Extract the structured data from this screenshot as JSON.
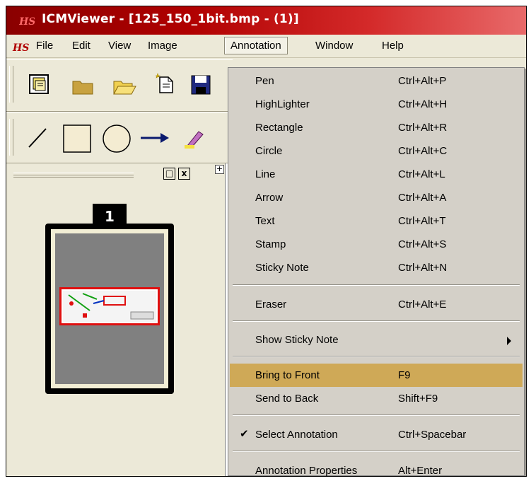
{
  "window": {
    "title": "ICMViewer - [125_150_1bit.bmp - (1)]"
  },
  "menubar": {
    "items": [
      "File",
      "Edit",
      "View",
      "Image",
      "Annotation",
      "Window",
      "Help"
    ]
  },
  "toolbar1": {
    "icons": [
      "scan-document-icon",
      "open-folder-icon",
      "open-folder-alt-icon",
      "new-page-icon",
      "save-icon"
    ]
  },
  "toolbar2": {
    "icons": [
      "line-tool-icon",
      "rectangle-tool-icon",
      "circle-tool-icon",
      "arrow-tool-icon",
      "highlighter-tool-icon"
    ]
  },
  "thumbnail": {
    "page_number": "1"
  },
  "pane": {
    "restore_label": "□",
    "close_label": "x"
  },
  "annotation_menu": {
    "items": [
      {
        "label": "Pen",
        "shortcut": "Ctrl+Alt+P"
      },
      {
        "label": "HighLighter",
        "shortcut": "Ctrl+Alt+H"
      },
      {
        "label": "Rectangle",
        "shortcut": "Ctrl+Alt+R"
      },
      {
        "label": "Circle",
        "shortcut": "Ctrl+Alt+C"
      },
      {
        "label": "Line",
        "shortcut": "Ctrl+Alt+L"
      },
      {
        "label": "Arrow",
        "shortcut": "Ctrl+Alt+A"
      },
      {
        "label": "Text",
        "shortcut": "Ctrl+Alt+T"
      },
      {
        "label": "Stamp",
        "shortcut": "Ctrl+Alt+S"
      },
      {
        "label": "Sticky Note",
        "shortcut": "Ctrl+Alt+N"
      },
      {
        "label": "Eraser",
        "shortcut": "Ctrl+Alt+E"
      },
      {
        "label": "Show Sticky Note",
        "shortcut": ""
      },
      {
        "label": "Bring to Front",
        "shortcut": "F9"
      },
      {
        "label": "Send to Back",
        "shortcut": "Shift+F9"
      },
      {
        "label": "Select Annotation",
        "shortcut": "Ctrl+Spacebar",
        "checked": true
      },
      {
        "label": "Annotation Properties",
        "shortcut": "Alt+Enter"
      }
    ],
    "highlighted": "Bring to Front"
  },
  "colors": {
    "title_bar": "#b00000",
    "menu_bg": "#d4d0c8",
    "highlight": "#cfa957",
    "pane_bg": "#ece9d8"
  }
}
